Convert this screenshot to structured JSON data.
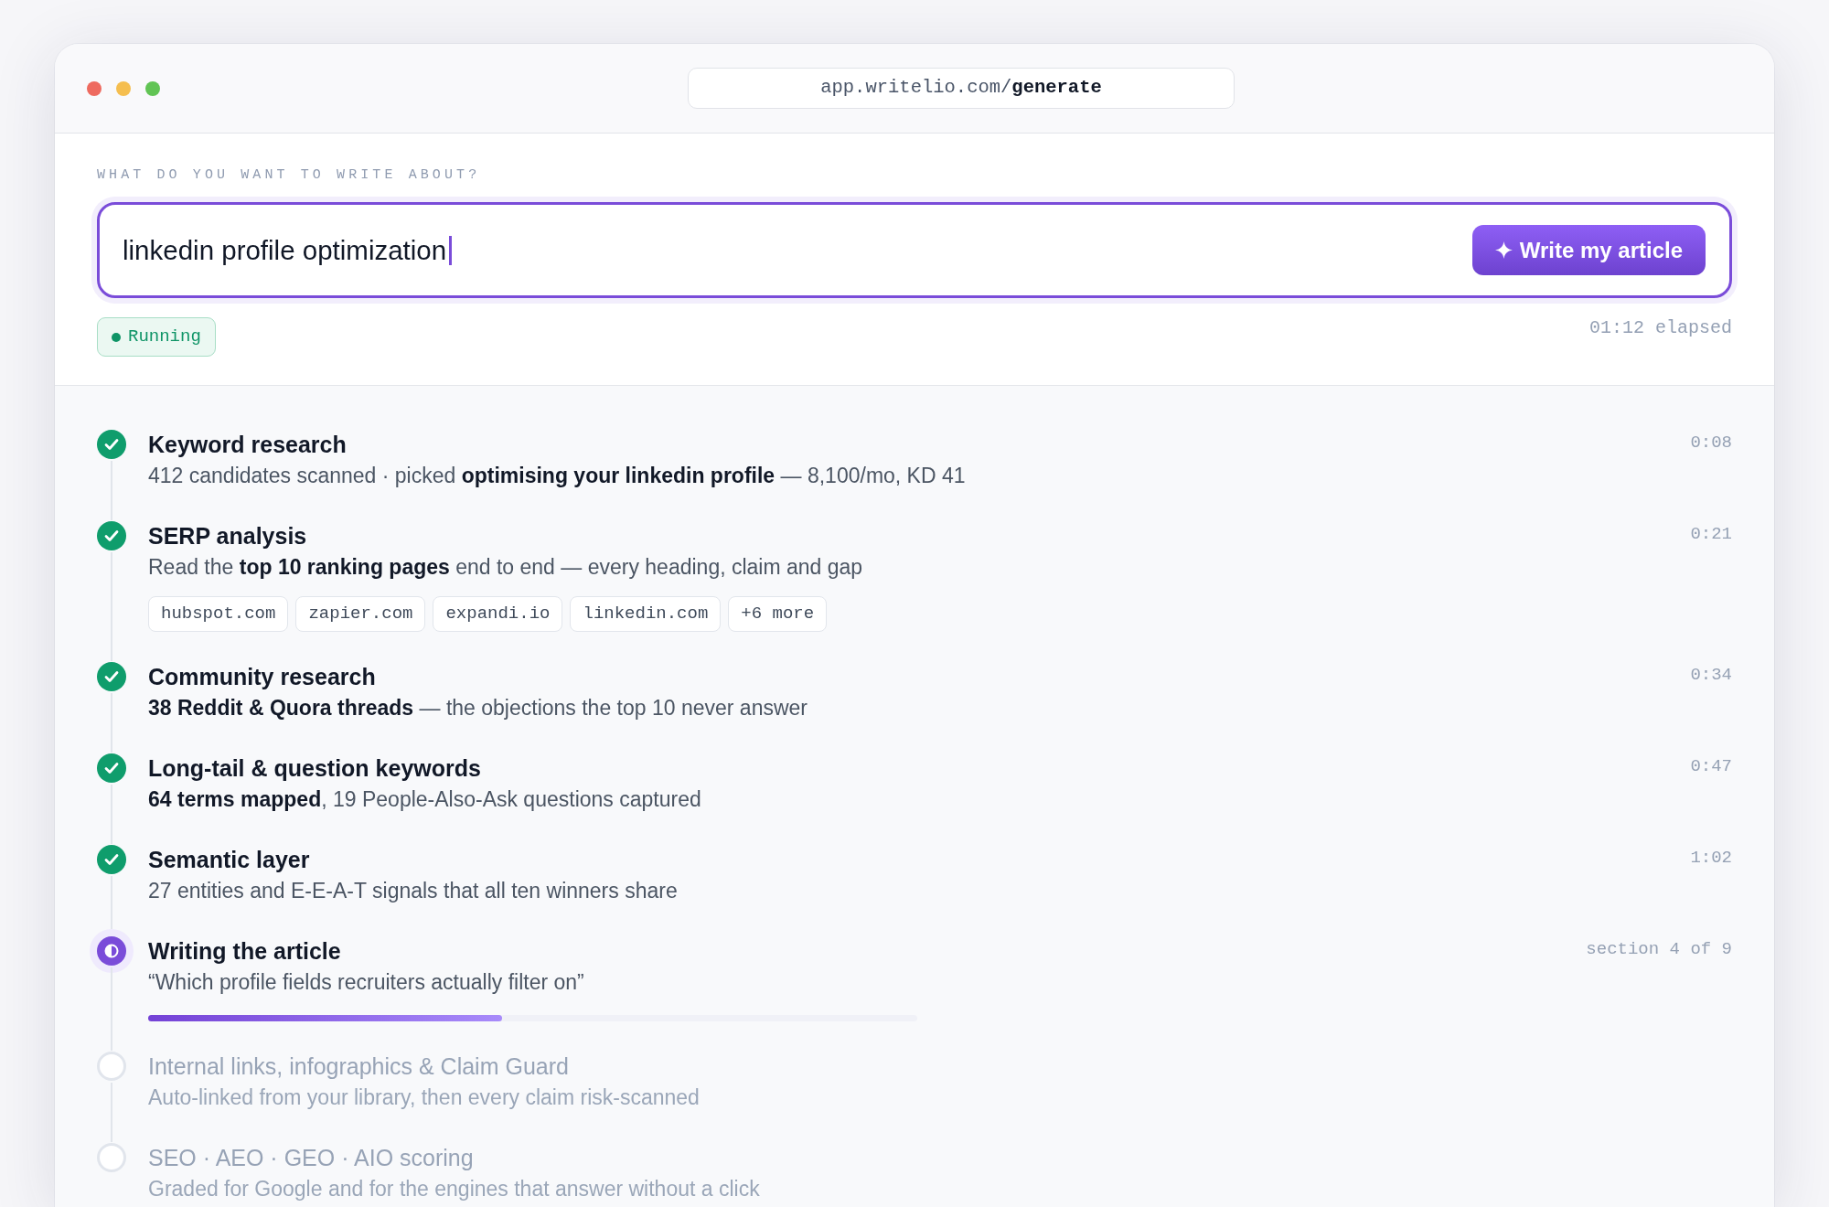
{
  "window": {
    "url": "app.writelio.com/**generate**"
  },
  "prompt": {
    "label": "WHAT DO YOU WANT TO WRITE ABOUT?",
    "value": "linkedin profile optimization",
    "focused": true,
    "button": "Write my article"
  },
  "run": {
    "running": true,
    "label": "Running",
    "elapsed": "01:12 elapsed"
  },
  "steps": [
    {
      "kind": "done",
      "title": "Keyword research",
      "description": "412 candidates scanned · picked **optimising your linkedin profile** — 8,100/mo, KD 41",
      "time": "0:08"
    },
    {
      "kind": "done",
      "title": "SERP analysis",
      "description": "Read the **top 10 ranking pages** end to end — every heading, claim and gap",
      "time": "0:21",
      "chips": [
        "hubspot.com",
        "zapier.com",
        "expandi.io",
        "linkedin.com",
        "+6 more"
      ]
    },
    {
      "kind": "done",
      "title": "Community research",
      "description": "**38 Reddit & Quora threads** — the objections the top 10 never answer",
      "time": "0:34"
    },
    {
      "kind": "done",
      "title": "Long-tail & question keywords",
      "description": "**64 terms mapped**, 19 People-Also-Ask questions captured",
      "time": "0:47"
    },
    {
      "kind": "done",
      "title": "Semantic layer",
      "description": "27 entities and E-E-A-T signals that all ten winners share",
      "time": "1:02"
    },
    {
      "kind": "active",
      "title": "Writing the article",
      "description": "“Which profile fields recruiters actually filter on”",
      "time": "section 4 of 9",
      "level": 0.46
    },
    {
      "kind": "pending",
      "title": "Internal links, infographics & Claim Guard",
      "description": "Auto-linked from your library, then every claim risk-scanned"
    },
    {
      "kind": "pending",
      "title": "SEO · AEO · GEO · AIO scoring",
      "description": "Graded for Google and for the engines that answer without a click"
    }
  ]
}
